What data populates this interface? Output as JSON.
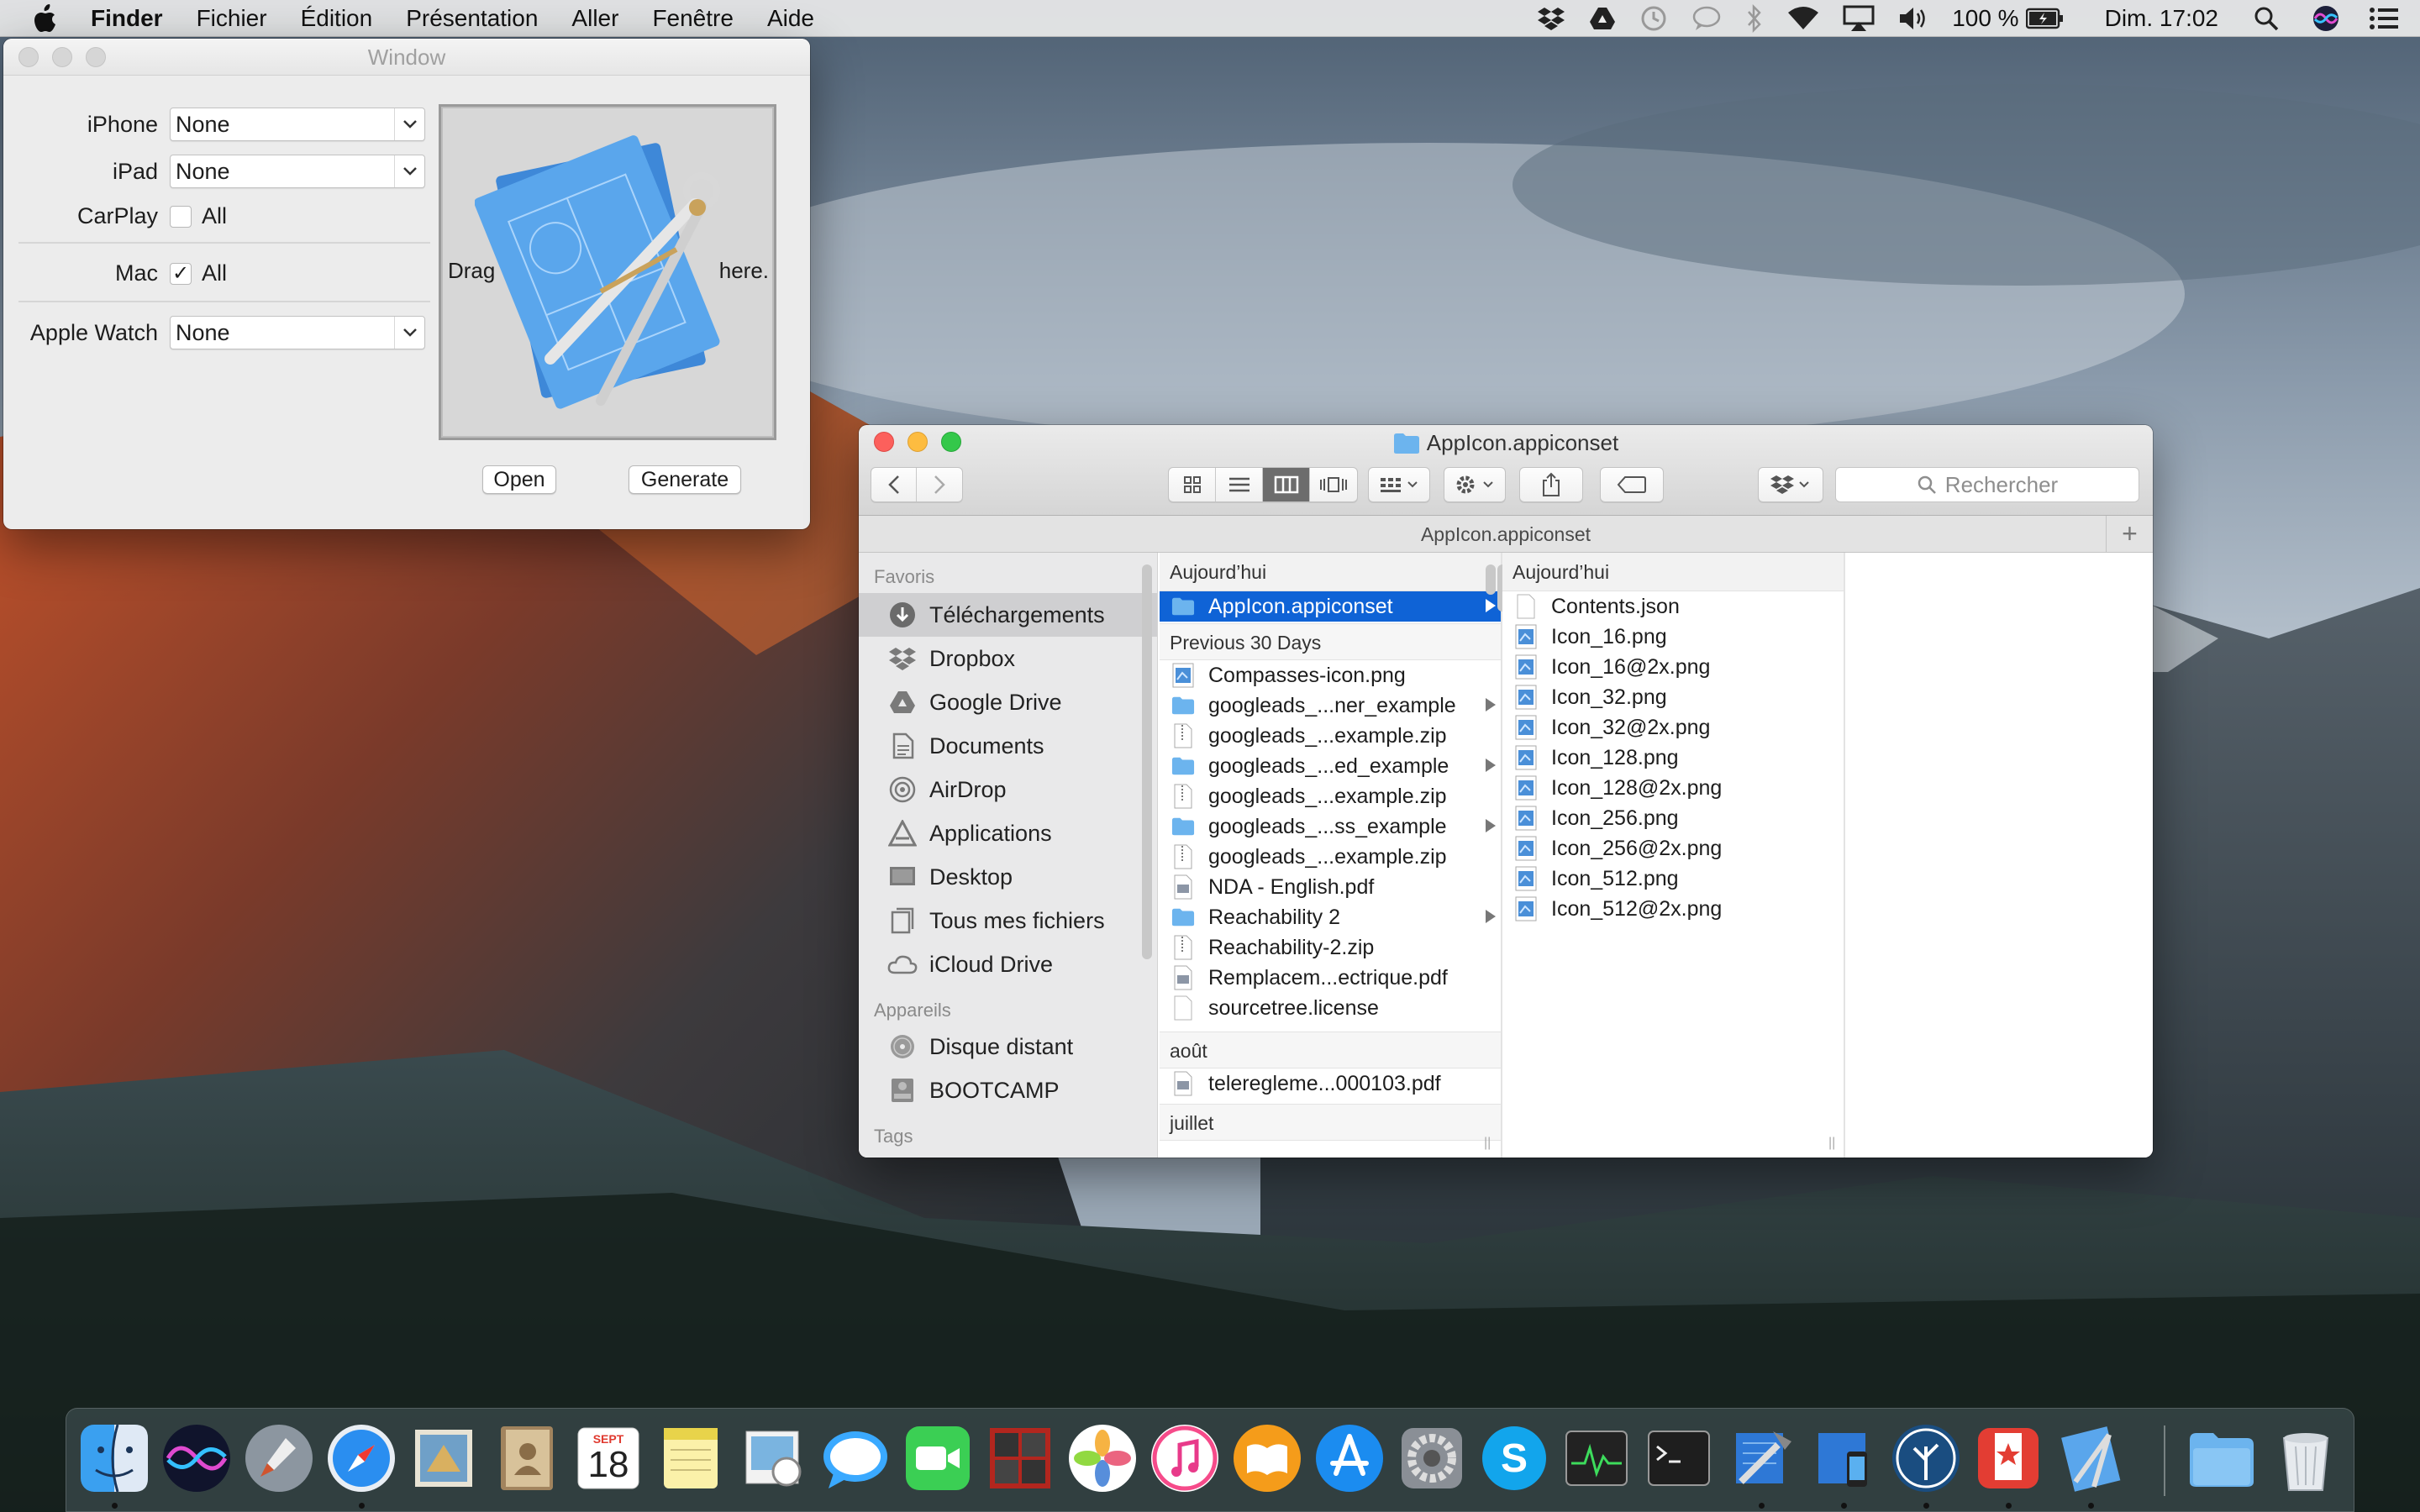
{
  "menubar": {
    "app_name": "Finder",
    "items": [
      "Fichier",
      "Édition",
      "Présentation",
      "Aller",
      "Fenêtre",
      "Aide"
    ],
    "battery": "100 %",
    "clock": "Dim. 17:02",
    "icons": [
      "apple-icon",
      "dropbox-icon",
      "google-drive-icon",
      "time-machine-icon",
      "messages-icon",
      "bluetooth-icon",
      "wifi-icon",
      "airplay-icon",
      "volume-icon",
      "battery-icon",
      "spotlight-icon",
      "siri-icon",
      "notification-center-icon"
    ]
  },
  "tool_window": {
    "title": "Window",
    "iphone_label": "iPhone",
    "iphone_value": "None",
    "ipad_label": "iPad",
    "ipad_value": "None",
    "carplay_label": "CarPlay",
    "carplay_check": "All",
    "carplay_checked": false,
    "mac_label": "Mac",
    "mac_check": "All",
    "mac_checked": true,
    "watch_label": "Apple Watch",
    "watch_value": "None",
    "drag_left": "Drag",
    "drag_right": "here.",
    "open_button": "Open",
    "generate_button": "Generate"
  },
  "finder": {
    "title": "AppIcon.appiconset",
    "path_title": "AppIcon.appiconset",
    "search_placeholder": "Rechercher",
    "sidebar": {
      "favorites_label": "Favoris",
      "favorites": [
        {
          "label": "Téléchargements",
          "icon": "downloads-icon",
          "selected": true
        },
        {
          "label": "Dropbox",
          "icon": "dropbox-icon"
        },
        {
          "label": "Google Drive",
          "icon": "google-drive-icon"
        },
        {
          "label": "Documents",
          "icon": "documents-icon"
        },
        {
          "label": "AirDrop",
          "icon": "airdrop-icon"
        },
        {
          "label": "Applications",
          "icon": "applications-icon"
        },
        {
          "label": "Desktop",
          "icon": "desktop-icon"
        },
        {
          "label": "Tous mes fichiers",
          "icon": "all-files-icon"
        },
        {
          "label": "iCloud Drive",
          "icon": "icloud-icon"
        }
      ],
      "devices_label": "Appareils",
      "devices": [
        {
          "label": "Disque distant",
          "icon": "remote-disc-icon"
        },
        {
          "label": "BOOTCAMP",
          "icon": "drive-icon"
        }
      ],
      "tags_label": "Tags"
    },
    "column1": {
      "header": "Aujourd’hui",
      "today": [
        {
          "name": "AppIcon.appiconset",
          "type": "folder",
          "selected": true,
          "arrow": true
        }
      ],
      "section_30days": "Previous 30 Days",
      "last30": [
        {
          "name": "Compasses-icon.png",
          "type": "image"
        },
        {
          "name": "googleads_...ner_example",
          "type": "folder",
          "arrow": true
        },
        {
          "name": "googleads_...example.zip",
          "type": "zip"
        },
        {
          "name": "googleads_...ed_example",
          "type": "folder",
          "arrow": true
        },
        {
          "name": "googleads_...example.zip",
          "type": "zip"
        },
        {
          "name": "googleads_...ss_example",
          "type": "folder",
          "arrow": true
        },
        {
          "name": "googleads_...example.zip",
          "type": "zip"
        },
        {
          "name": "NDA - English.pdf",
          "type": "pdf"
        },
        {
          "name": "Reachability 2",
          "type": "folder",
          "arrow": true
        },
        {
          "name": "Reachability-2.zip",
          "type": "zip"
        },
        {
          "name": "Remplacem...ectrique.pdf",
          "type": "pdf"
        },
        {
          "name": "sourcetree.license",
          "type": "doc"
        }
      ],
      "section_aout": "août",
      "aout": [
        {
          "name": "telereglеme...000103.pdf",
          "type": "pdf"
        }
      ],
      "section_juillet": "juillet"
    },
    "column2": {
      "header": "Aujourd’hui",
      "files": [
        {
          "name": "Contents.json",
          "type": "doc"
        },
        {
          "name": "Icon_16.png",
          "type": "image"
        },
        {
          "name": "Icon_16@2x.png",
          "type": "image"
        },
        {
          "name": "Icon_32.png",
          "type": "image"
        },
        {
          "name": "Icon_32@2x.png",
          "type": "image"
        },
        {
          "name": "Icon_128.png",
          "type": "image"
        },
        {
          "name": "Icon_128@2x.png",
          "type": "image"
        },
        {
          "name": "Icon_256.png",
          "type": "image"
        },
        {
          "name": "Icon_256@2x.png",
          "type": "image"
        },
        {
          "name": "Icon_512.png",
          "type": "image"
        },
        {
          "name": "Icon_512@2x.png",
          "type": "image"
        }
      ]
    }
  },
  "dock": {
    "calendar_month": "SEPT",
    "calendar_day": "18",
    "apps": [
      {
        "name": "finder-icon",
        "running": true
      },
      {
        "name": "siri-icon"
      },
      {
        "name": "launchpad-icon"
      },
      {
        "name": "safari-icon",
        "running": true
      },
      {
        "name": "mail-icon"
      },
      {
        "name": "contacts-icon"
      },
      {
        "name": "calendar-icon"
      },
      {
        "name": "notes-icon"
      },
      {
        "name": "preview-icon"
      },
      {
        "name": "messages-icon"
      },
      {
        "name": "facetime-icon"
      },
      {
        "name": "photo-booth-icon"
      },
      {
        "name": "photos-icon"
      },
      {
        "name": "itunes-icon"
      },
      {
        "name": "ibooks-icon"
      },
      {
        "name": "app-store-icon"
      },
      {
        "name": "system-preferences-icon"
      },
      {
        "name": "skype-icon"
      },
      {
        "name": "activity-monitor-icon"
      },
      {
        "name": "terminal-icon"
      },
      {
        "name": "xcode-icon",
        "running": true
      },
      {
        "name": "simulator-icon",
        "running": true
      },
      {
        "name": "sourcetree-icon",
        "running": true
      },
      {
        "name": "wunderlist-icon",
        "running": true
      },
      {
        "name": "icon-generator-icon",
        "running": true
      },
      {
        "name": "downloads-stack-icon"
      },
      {
        "name": "trash-icon"
      }
    ]
  }
}
